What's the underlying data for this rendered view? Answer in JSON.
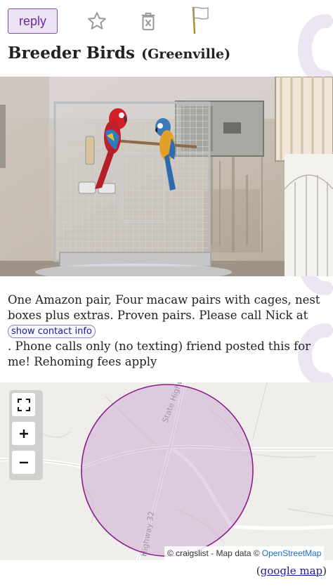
{
  "toolbar": {
    "reply_label": "reply",
    "icons": [
      "star-icon",
      "trash-icon",
      "flag-icon"
    ]
  },
  "title": {
    "main": "Breeder Birds",
    "location": "(Greenville)"
  },
  "description": {
    "line_before": "One Amazon pair, Four macaw pairs with cages, nest boxes plus extras. Proven pairs. Please call Nick at",
    "contact_button": "show contact info",
    "line_after": ". Phone calls only (no texting) friend posted this for me! Rehoming fees apply"
  },
  "map": {
    "road_labels": [
      "State Highway",
      "Highway 32"
    ],
    "attribution": "© craigslist - Map data ©",
    "attribution_link": "OpenStreetMap",
    "google_map_label": "google map",
    "circle_color": "#8b1c8b",
    "controls": [
      "fullscreen-icon",
      "zoom-in-icon",
      "zoom-out-icon"
    ]
  },
  "colors": {
    "accent": "#6a2d9b",
    "link": "#1a1a9a"
  }
}
